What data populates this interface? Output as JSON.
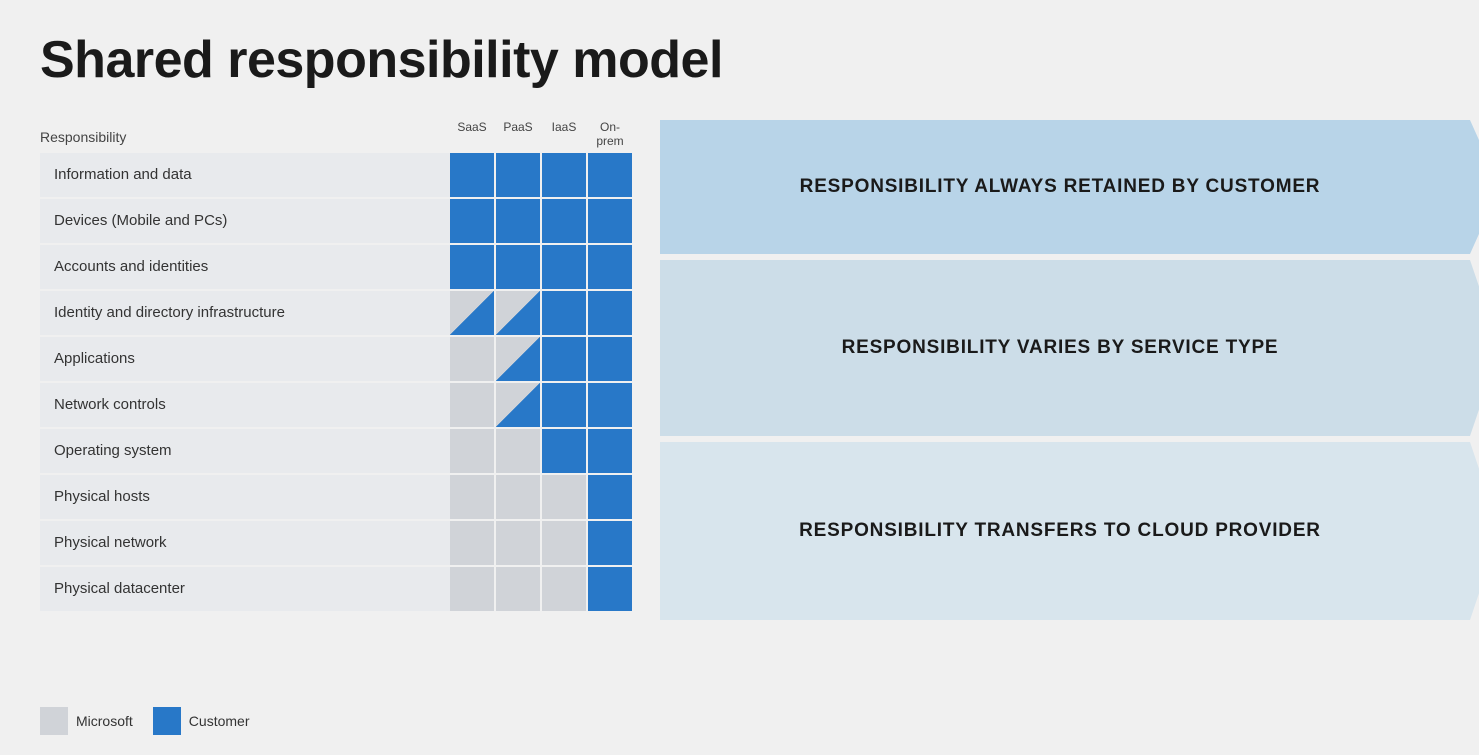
{
  "title": "Shared responsibility model",
  "table": {
    "header": {
      "row_label": "Responsibility",
      "columns": [
        "SaaS",
        "PaaS",
        "IaaS",
        "On-prem"
      ]
    },
    "rows": [
      {
        "label": "Information and data",
        "cells": [
          "blue",
          "blue",
          "blue",
          "blue"
        ]
      },
      {
        "label": "Devices (Mobile and PCs)",
        "cells": [
          "blue",
          "blue",
          "blue",
          "blue"
        ]
      },
      {
        "label": "Accounts and identities",
        "cells": [
          "blue",
          "blue",
          "blue",
          "blue"
        ]
      },
      {
        "label": "Identity and directory infrastructure",
        "cells": [
          "half",
          "half",
          "blue",
          "blue"
        ]
      },
      {
        "label": "Applications",
        "cells": [
          "gray",
          "half",
          "blue",
          "blue"
        ]
      },
      {
        "label": "Network controls",
        "cells": [
          "gray",
          "half",
          "blue",
          "blue"
        ]
      },
      {
        "label": "Operating system",
        "cells": [
          "gray",
          "gray",
          "blue",
          "blue"
        ]
      },
      {
        "label": "Physical hosts",
        "cells": [
          "gray",
          "gray",
          "gray",
          "blue"
        ]
      },
      {
        "label": "Physical network",
        "cells": [
          "gray",
          "gray",
          "gray",
          "blue"
        ]
      },
      {
        "label": "Physical datacenter",
        "cells": [
          "gray",
          "gray",
          "gray",
          "blue"
        ]
      }
    ]
  },
  "arrows": [
    {
      "label": "RESPONSIBILITY ALWAYS RETAINED BY CUSTOMER",
      "rows_covered": 3
    },
    {
      "label": "RESPONSIBILITY VARIES BY SERVICE TYPE",
      "rows_covered": 4
    },
    {
      "label": "RESPONSIBILITY TRANSFERS TO CLOUD PROVIDER",
      "rows_covered": 3
    }
  ],
  "legend": {
    "microsoft_label": "Microsoft",
    "customer_label": "Customer"
  }
}
